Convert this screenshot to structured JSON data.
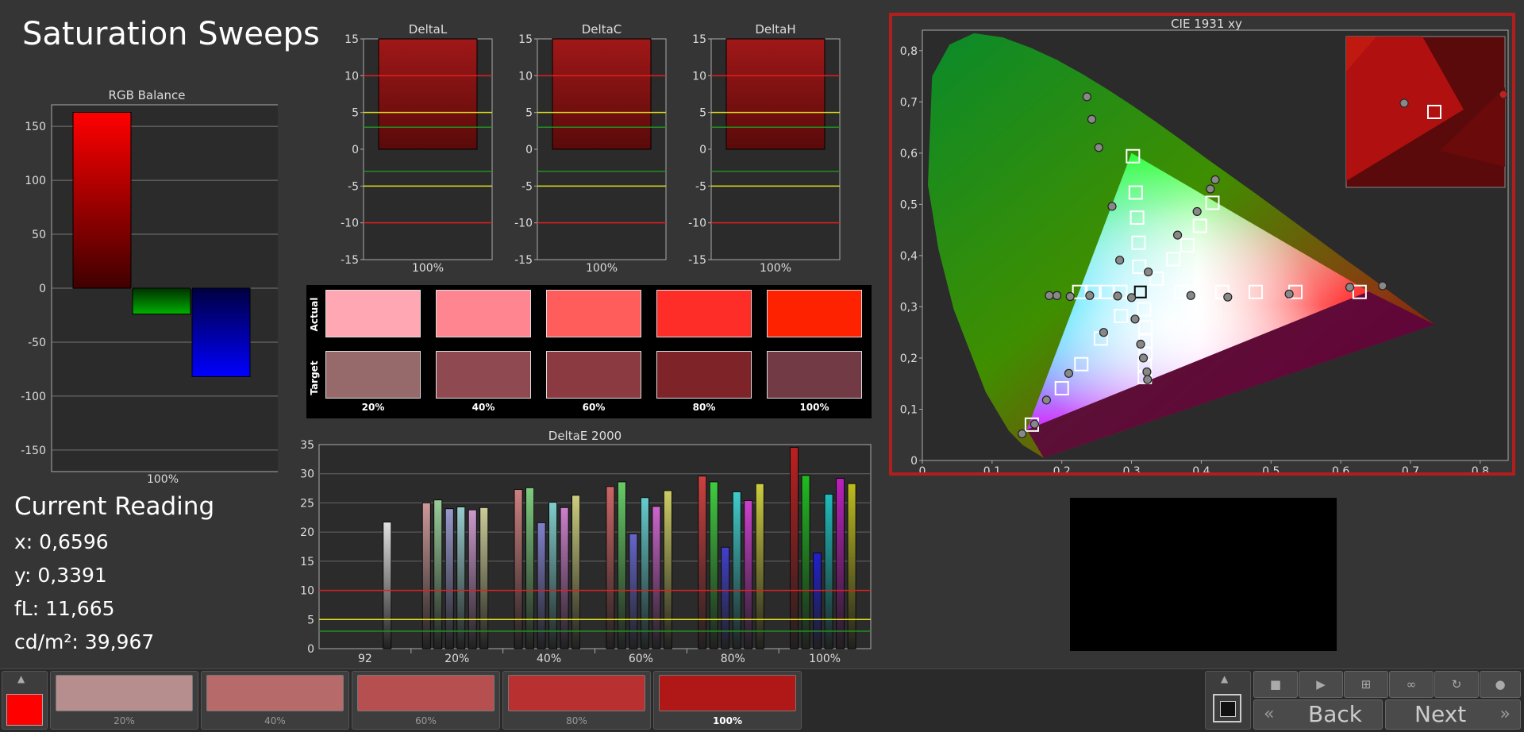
{
  "page": {
    "title": "Saturation Sweeps"
  },
  "reading": {
    "title": "Current Reading",
    "x": "x: 0,6596",
    "y": "y: 0,3391",
    "fl": "fL: 11,665",
    "cdm2": "cd/m²: 39,967"
  },
  "rgb_balance": {
    "title": "RGB Balance",
    "xlabel": "100%",
    "yticks": [
      "150",
      "100",
      "50",
      "0",
      "-50",
      "-100",
      "-150"
    ],
    "chart_data": {
      "type": "bar",
      "categories": [
        "R",
        "G",
        "B"
      ],
      "values": [
        163,
        -24,
        -82
      ],
      "ylim": [
        -170,
        170
      ],
      "colors": [
        "#ff0000",
        "#00b000",
        "#0000ff"
      ]
    }
  },
  "delta_charts": [
    {
      "title": "DeltaL",
      "xlabel": "100%"
    },
    {
      "title": "DeltaC",
      "xlabel": "100%"
    },
    {
      "title": "DeltaH",
      "xlabel": "100%"
    }
  ],
  "delta_yticks": [
    "15",
    "10",
    "5",
    "0",
    "-5",
    "-10",
    "-15"
  ],
  "swatches": {
    "actual_label": "Actual",
    "target_label": "Target",
    "labels": [
      "20%",
      "40%",
      "60%",
      "80%",
      "100%"
    ],
    "actual_colors": [
      "#ffa8b3",
      "#ff8590",
      "#ff5c5c",
      "#ff2d28",
      "#ff2200"
    ],
    "target_colors": [
      "#966a6a",
      "#8e4a50",
      "#8a3a40",
      "#7e2428",
      "#713a45"
    ]
  },
  "deltae": {
    "title": "DeltaE 2000",
    "categories": [
      "92",
      "20%",
      "40%",
      "60%",
      "80%",
      "100%"
    ],
    "yticks": [
      "35",
      "30",
      "25",
      "20",
      "15",
      "10",
      "5",
      "0"
    ],
    "chart_data": {
      "type": "bar",
      "ylim": [
        0,
        35
      ],
      "groups": [
        {
          "label": "92",
          "values": [
            21.7
          ],
          "colors": [
            "#e0e0e0"
          ]
        },
        {
          "label": "20%",
          "values": [
            25,
            25.5,
            24,
            24.3,
            23.8,
            24.2
          ],
          "colors": [
            "#cc9999",
            "#99cc99",
            "#9999cc",
            "#99cccc",
            "#cc99cc",
            "#cccc99"
          ]
        },
        {
          "label": "40%",
          "values": [
            27.3,
            27.6,
            21.6,
            25.1,
            24.2,
            26.3
          ],
          "colors": [
            "#cc8080",
            "#80cc80",
            "#8080cc",
            "#80cccc",
            "#cc80cc",
            "#cccc80"
          ]
        },
        {
          "label": "60%",
          "values": [
            27.8,
            28.6,
            19.7,
            25.9,
            24.4,
            27.1
          ],
          "colors": [
            "#cc6666",
            "#66cc66",
            "#6666cc",
            "#66cccc",
            "#cc66cc",
            "#cccc66"
          ]
        },
        {
          "label": "80%",
          "values": [
            29.6,
            28.6,
            17.4,
            26.9,
            25.4,
            28.3
          ],
          "colors": [
            "#cc4040",
            "#40cc40",
            "#4040cc",
            "#40cccc",
            "#cc40cc",
            "#cccc40"
          ]
        },
        {
          "label": "100%",
          "values": [
            34.5,
            29.7,
            16.4,
            26.5,
            29.2,
            28.3
          ],
          "colors": [
            "#bb2020",
            "#20bb20",
            "#2020cc",
            "#20bbbb",
            "#bb20bb",
            "#bbbb20"
          ]
        }
      ]
    }
  },
  "cie": {
    "title": "CIE 1931 xy",
    "xticks": [
      "0",
      "0,1",
      "0,2",
      "0,3",
      "0,4",
      "0,5",
      "0,6",
      "0,7",
      "0,8"
    ],
    "yticks": [
      "0",
      "0,1",
      "0,2",
      "0,3",
      "0,4",
      "0,5",
      "0,6",
      "0,7",
      "0,8"
    ],
    "chart_data": {
      "type": "scatter",
      "xlim": [
        0,
        0.84
      ],
      "ylim": [
        0,
        0.84
      ],
      "gamut": [
        [
          0.64,
          0.33
        ],
        [
          0.3,
          0.6
        ],
        [
          0.15,
          0.06
        ]
      ],
      "targets": [
        [
          0.3127,
          0.329
        ],
        [
          0.302,
          0.594
        ],
        [
          0.306,
          0.523
        ],
        [
          0.308,
          0.474
        ],
        [
          0.31,
          0.425
        ],
        [
          0.311,
          0.378
        ],
        [
          0.225,
          0.329
        ],
        [
          0.245,
          0.329
        ],
        [
          0.265,
          0.329
        ],
        [
          0.284,
          0.329
        ],
        [
          0.157,
          0.07
        ],
        [
          0.2,
          0.141
        ],
        [
          0.228,
          0.188
        ],
        [
          0.256,
          0.238
        ],
        [
          0.285,
          0.282
        ],
        [
          0.318,
          0.295
        ],
        [
          0.32,
          0.26
        ],
        [
          0.32,
          0.233
        ],
        [
          0.32,
          0.208
        ],
        [
          0.319,
          0.185
        ],
        [
          0.319,
          0.163
        ],
        [
          0.336,
          0.355
        ],
        [
          0.36,
          0.393
        ],
        [
          0.38,
          0.42
        ],
        [
          0.398,
          0.458
        ],
        [
          0.416,
          0.503
        ],
        [
          0.372,
          0.329
        ],
        [
          0.43,
          0.329
        ],
        [
          0.478,
          0.329
        ],
        [
          0.535,
          0.329
        ],
        [
          0.627,
          0.329
        ]
      ],
      "points": [
        [
          0.236,
          0.71
        ],
        [
          0.243,
          0.666
        ],
        [
          0.253,
          0.611
        ],
        [
          0.272,
          0.496
        ],
        [
          0.283,
          0.391
        ],
        [
          0.26,
          0.25
        ],
        [
          0.21,
          0.17
        ],
        [
          0.178,
          0.118
        ],
        [
          0.161,
          0.071
        ],
        [
          0.143,
          0.052
        ],
        [
          0.182,
          0.322
        ],
        [
          0.193,
          0.322
        ],
        [
          0.212,
          0.32
        ],
        [
          0.24,
          0.322
        ],
        [
          0.28,
          0.321
        ],
        [
          0.3,
          0.318
        ],
        [
          0.305,
          0.276
        ],
        [
          0.313,
          0.227
        ],
        [
          0.317,
          0.2
        ],
        [
          0.322,
          0.173
        ],
        [
          0.323,
          0.158
        ],
        [
          0.324,
          0.368
        ],
        [
          0.366,
          0.44
        ],
        [
          0.385,
          0.322
        ],
        [
          0.394,
          0.486
        ],
        [
          0.413,
          0.53
        ],
        [
          0.42,
          0.548
        ],
        [
          0.438,
          0.319
        ],
        [
          0.526,
          0.325
        ],
        [
          0.613,
          0.338
        ],
        [
          0.66,
          0.341
        ]
      ]
    }
  },
  "bottom": {
    "swatch_labels": [
      "20%",
      "40%",
      "60%",
      "80%",
      "100%"
    ],
    "swatch_colors": [
      "#b78e8e",
      "#b66a6a",
      "#b65050",
      "#b93030",
      "#b01818"
    ],
    "current_color": "#ff0000",
    "back": "Back",
    "next": "Next"
  }
}
